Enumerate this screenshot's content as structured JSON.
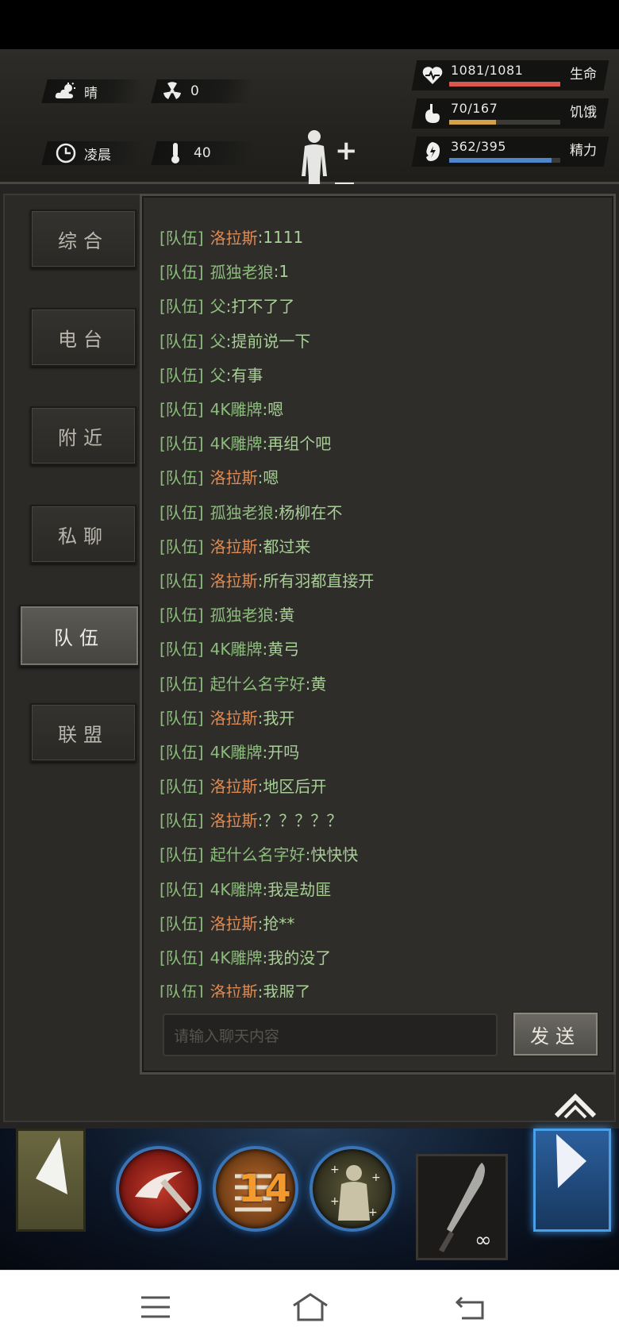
{
  "status": {
    "weather": "晴",
    "radiation": "0",
    "time_of_day": "凌晨",
    "temperature": "40",
    "stats": [
      {
        "label": "生命",
        "value": "1081/1081",
        "fraction": 1.0,
        "color": "#d9574f",
        "icon": "heart-icon"
      },
      {
        "label": "饥饿",
        "value": "70/167",
        "fraction": 0.42,
        "color": "#d4a148",
        "icon": "stomach-icon"
      },
      {
        "label": "精力",
        "value": "362/395",
        "fraction": 0.92,
        "color": "#4f86c9",
        "icon": "energy-icon"
      }
    ]
  },
  "tabs": [
    "综合",
    "电台",
    "附近",
    "私聊",
    "队伍",
    "联盟"
  ],
  "active_tab": "队伍",
  "chat": {
    "channel": "[队伍]",
    "messages": [
      {
        "name": "洛拉斯",
        "text": ":1111",
        "orange": true
      },
      {
        "name": "孤独老狼",
        "text": ":1",
        "orange": false
      },
      {
        "name": "父",
        "text": ":打不了了",
        "orange": false
      },
      {
        "name": "父",
        "text": ":提前说一下",
        "orange": false
      },
      {
        "name": "父",
        "text": ":有事",
        "orange": false
      },
      {
        "name": "4K雕牌",
        "text": ":嗯",
        "orange": false
      },
      {
        "name": "4K雕牌",
        "text": ":再组个吧",
        "orange": false
      },
      {
        "name": "洛拉斯",
        "text": ":嗯",
        "orange": true
      },
      {
        "name": "孤独老狼",
        "text": ":杨柳在不",
        "orange": false
      },
      {
        "name": "洛拉斯",
        "text": ":都过来",
        "orange": true
      },
      {
        "name": "洛拉斯",
        "text": ":所有羽都直接开",
        "orange": true
      },
      {
        "name": "孤独老狼",
        "text": ":黄",
        "orange": false
      },
      {
        "name": "4K雕牌",
        "text": ":黄弓",
        "orange": false
      },
      {
        "name": "起什么名字好",
        "text": ":黄",
        "orange": false
      },
      {
        "name": "洛拉斯",
        "text": ":我开",
        "orange": true
      },
      {
        "name": "4K雕牌",
        "text": ":开吗",
        "orange": false
      },
      {
        "name": "洛拉斯",
        "text": ":地区后开",
        "orange": true
      },
      {
        "name": "洛拉斯",
        "text": ":？？？？？",
        "orange": true
      },
      {
        "name": "起什么名字好",
        "text": ":快快快",
        "orange": false
      },
      {
        "name": "4K雕牌",
        "text": ":我是劫匪",
        "orange": false
      },
      {
        "name": "洛拉斯",
        "text": ":抢**",
        "orange": true
      },
      {
        "name": "4K雕牌",
        "text": ":我的没了",
        "orange": false
      },
      {
        "name": "洛拉斯",
        "text": ":我服了",
        "orange": true
      }
    ],
    "input_placeholder": "请输入聊天内容",
    "send_label": "发送"
  },
  "skills": {
    "count": "14",
    "weapon_durability": "∞"
  }
}
